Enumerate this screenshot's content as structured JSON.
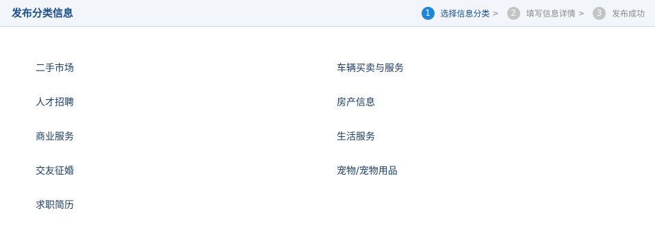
{
  "header": {
    "title": "发布分类信息",
    "steps": [
      {
        "num": "1",
        "label": "选择信息分类",
        "arrow": ">"
      },
      {
        "num": "2",
        "label": "填写信息详情",
        "arrow": ">"
      },
      {
        "num": "3",
        "label": "发布成功",
        "arrow": ""
      }
    ],
    "active_step": 1
  },
  "categories": [
    "二手市场",
    "车辆买卖与服务",
    "人才招聘",
    "房产信息",
    "商业服务",
    "生活服务",
    "交友征婚",
    "宠物/宠物用品",
    "求职简历"
  ],
  "colors": {
    "header_bg": "#f2f6fb",
    "title": "#1a4f8b",
    "active_step": "#1f87d6",
    "inactive_step": "#c4c4c4",
    "link": "#1b3d66"
  }
}
